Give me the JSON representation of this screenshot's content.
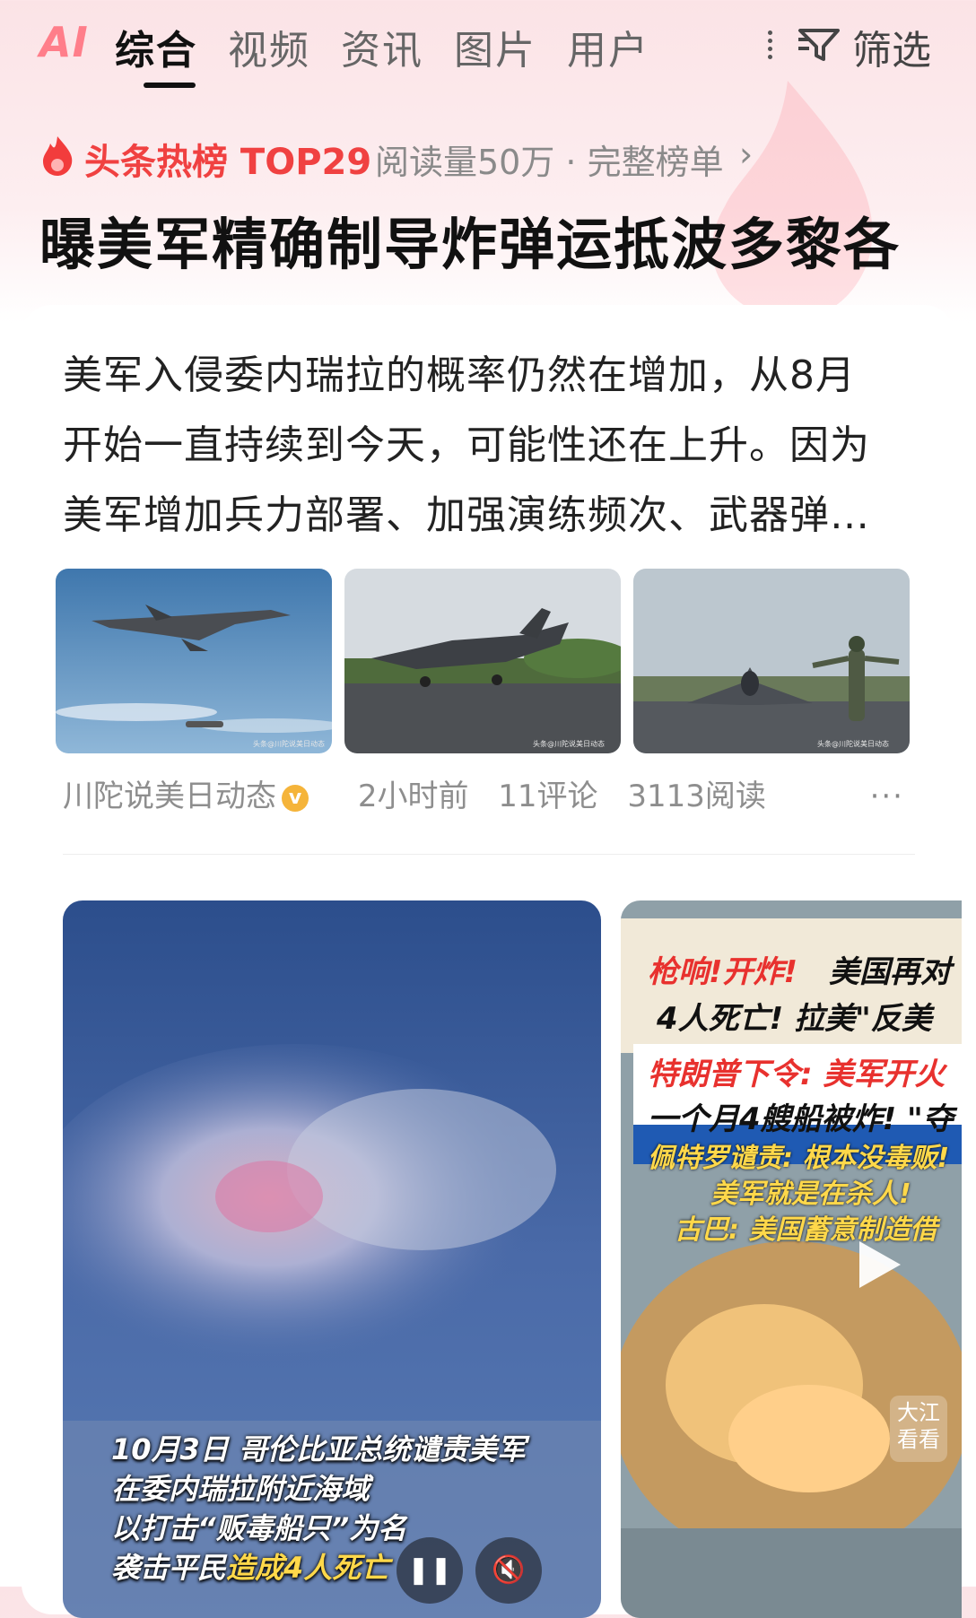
{
  "top_tabs": {
    "ai_label": "AI",
    "items": [
      "综合",
      "视频",
      "资讯",
      "图片",
      "用户"
    ],
    "active_index": 0,
    "filter_label": "筛选"
  },
  "hot_rank": {
    "title": "头条热榜 TOP29",
    "meta": "阅读量50万 · 完整榜单",
    "chevron": "›",
    "headline": "曝美军精确制导炸弹运抵波多黎各"
  },
  "article": {
    "lines": [
      "美军入侵委内瑞拉的概率仍然在增加，从8月",
      "开始一直持续到今天，可能性还在上升。因为",
      "美军增加兵力部署、加强演练频次、武器弹…"
    ],
    "images": [
      "f35-flying-image",
      "f35-ground-image",
      "f35-runway-marshal-image"
    ],
    "author": "川陀说美日动态",
    "verified_mark": "v",
    "time": "2小时前",
    "comments": "11评论",
    "reads": "3113阅读",
    "more": "···"
  },
  "video_big": {
    "caption_lines": [
      "10月3日 哥伦比亚总统谴责美军",
      "在委内瑞拉附近海域",
      "以打击“贩毒船只”为名"
    ],
    "caption_last_prefix": "袭击平民",
    "caption_last_highlight": "造成4人死亡",
    "pause_icon": "❚❚",
    "mute_icon": "🔇"
  },
  "video_small": {
    "line1_red": "枪响!开炸!",
    "line1_rest": "美国再对",
    "line2": "4人死亡! 拉美\"反美",
    "line3": "特朗普下令: 美军开火",
    "line4": "一个月4艘船被炸! \"夺",
    "line5": "佩特罗谴责: 根本没毒贩!",
    "line6": "美军就是在杀人!",
    "line7": "古巴: 美国蓄意制造借",
    "watermark_line1": "大江",
    "watermark_line2": "看看"
  },
  "colors": {
    "accent_red": "#f04141",
    "highlight_yellow": "#ffd84a",
    "verified_gold": "#f5b43a"
  }
}
